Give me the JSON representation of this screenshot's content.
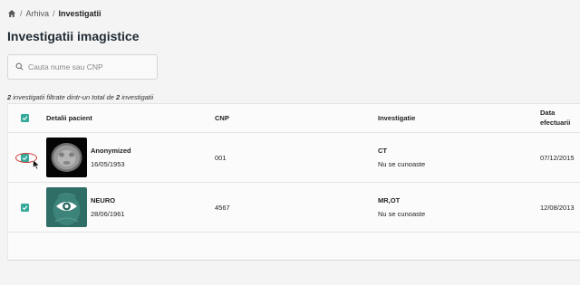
{
  "breadcrumb": {
    "home_icon": "home-icon",
    "separator": "/",
    "items": [
      "Arhiva",
      "Investigatii"
    ]
  },
  "page_title": "Investigatii imagistice",
  "search": {
    "icon": "search-icon",
    "placeholder": "Cauta nume sau CNP",
    "value": ""
  },
  "summary": {
    "filtered_count": "2",
    "middle_text": " investigatii filtrate dintr-un total de ",
    "total_count": "2",
    "end_text": " investigatii"
  },
  "table": {
    "columns": {
      "select_all_checked": true,
      "patient": "Detalii pacient",
      "cnp": "CNP",
      "investigation": "Investigatie",
      "date_line1": "Data",
      "date_line2": "efectuarii"
    },
    "rows": [
      {
        "checked": true,
        "thumbnail": "ct-scan-thumbnail",
        "name": "Anonymized",
        "birth_date": "16/05/1953",
        "cnp": "001",
        "modality": "CT",
        "description": "Nu se cunoaste",
        "date": "07/12/2015"
      },
      {
        "checked": true,
        "thumbnail": "neuro-eye-thumbnail",
        "name": "NEURO",
        "birth_date": "28/06/1961",
        "cnp": "4567",
        "modality": "MR,OT",
        "description": "Nu se cunoaste",
        "date": "12/08/2013"
      }
    ]
  },
  "colors": {
    "accent": "#35a99a",
    "highlight": "#d23b3b",
    "background": "#f4f4f4"
  }
}
